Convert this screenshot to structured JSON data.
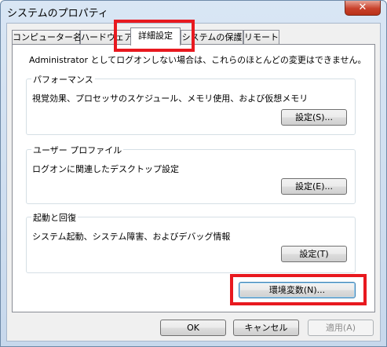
{
  "window": {
    "title": "システムのプロパティ",
    "close_glyph": "✕"
  },
  "tabs": [
    {
      "label": "コンピューター名"
    },
    {
      "label": "ハードウェア"
    },
    {
      "label": "詳細設定"
    },
    {
      "label": "システムの保護"
    },
    {
      "label": "リモート"
    }
  ],
  "active_tab": "詳細設定",
  "panel": {
    "notice": "Administrator としてログオンしない場合は、これらのほとんどの変更はできません。",
    "groups": [
      {
        "label": "パフォーマンス",
        "description": "視覚効果、プロセッサのスケジュール、メモリ使用、および仮想メモリ",
        "button": "設定(S)..."
      },
      {
        "label": "ユーザー プロファイル",
        "description": "ログオンに関連したデスクトップ設定",
        "button": "設定(E)..."
      },
      {
        "label": "起動と回復",
        "description": "システム起動、システム障害、およびデバッグ情報",
        "button": "設定(T)"
      }
    ],
    "env_button": "環境変数(N)..."
  },
  "footer": {
    "ok": "OK",
    "cancel": "キャンセル",
    "apply": "適用(A)"
  },
  "colors": {
    "highlight": "#e8191f",
    "title_bg": "#d9e6f4",
    "close_btn": "#c8412b"
  }
}
